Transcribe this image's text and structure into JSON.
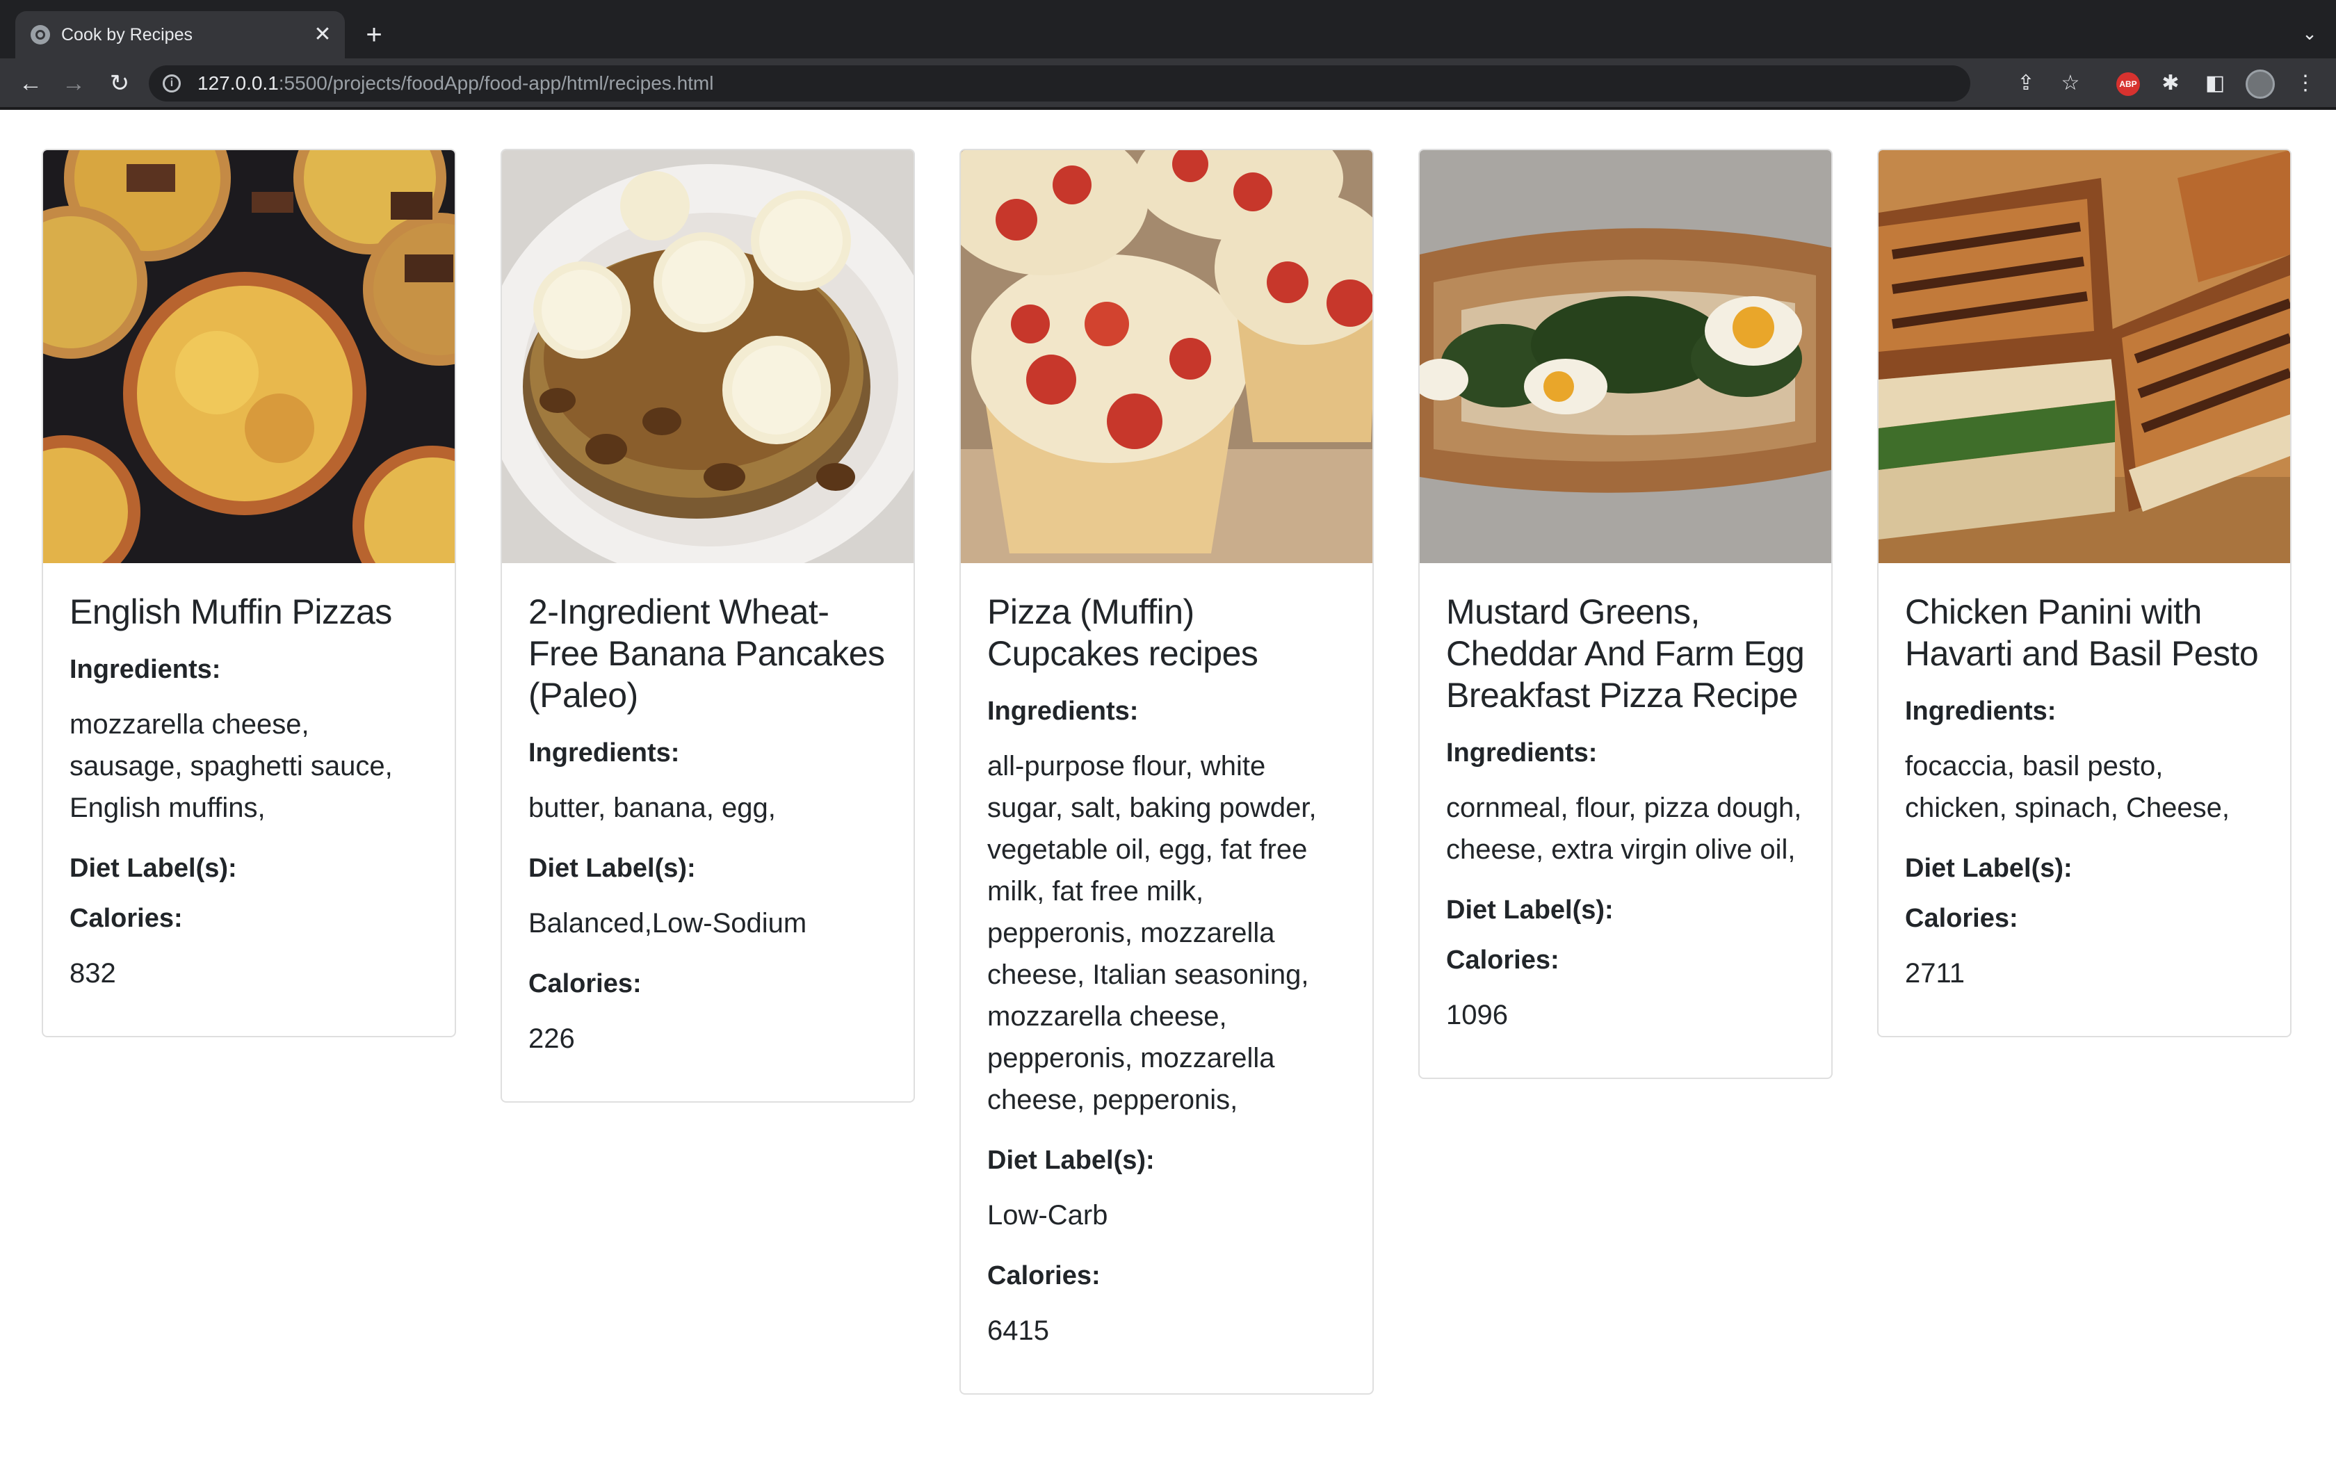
{
  "browser": {
    "tab_title": "Cook by Recipes",
    "url_host": "127.0.0.1",
    "url_path": ":5500/projects/foodApp/food-app/html/recipes.html"
  },
  "labels": {
    "ingredients": "Ingredients:",
    "diet": "Diet Label(s):",
    "calories": "Calories:"
  },
  "recipes": [
    {
      "title": "English Muffin Pizzas",
      "ingredients": "mozzarella cheese, sausage, spaghetti sauce, English muffins,",
      "diet_labels": "",
      "calories": "832",
      "image": "english-muffin-pizzas-photo"
    },
    {
      "title": "2-Ingredient Wheat-Free Banana Pancakes (Paleo)",
      "ingredients": "butter, banana, egg,",
      "diet_labels": "Balanced,Low-Sodium",
      "calories": "226",
      "image": "banana-pancakes-photo"
    },
    {
      "title": "Pizza (Muffin) Cupcakes recipes",
      "ingredients": "all-purpose flour, white sugar, salt, baking powder, vegetable oil, egg, fat free milk, fat free milk, pepperonis, mozzarella cheese, Italian seasoning, mozzarella cheese, pepperonis, mozzarella cheese, pepperonis,",
      "diet_labels": "Low-Carb",
      "calories": "6415",
      "image": "pizza-cupcakes-photo"
    },
    {
      "title": "Mustard Greens, Cheddar And Farm Egg Breakfast Pizza Recipe",
      "ingredients": "cornmeal, flour, pizza dough, cheese, extra virgin olive oil,",
      "diet_labels": "",
      "calories": "1096",
      "image": "breakfast-pizza-photo"
    },
    {
      "title": "Chicken Panini with Havarti and Basil Pesto",
      "ingredients": "focaccia, basil pesto, chicken, spinach, Cheese,",
      "diet_labels": "",
      "calories": "2711",
      "image": "chicken-panini-photo"
    }
  ]
}
